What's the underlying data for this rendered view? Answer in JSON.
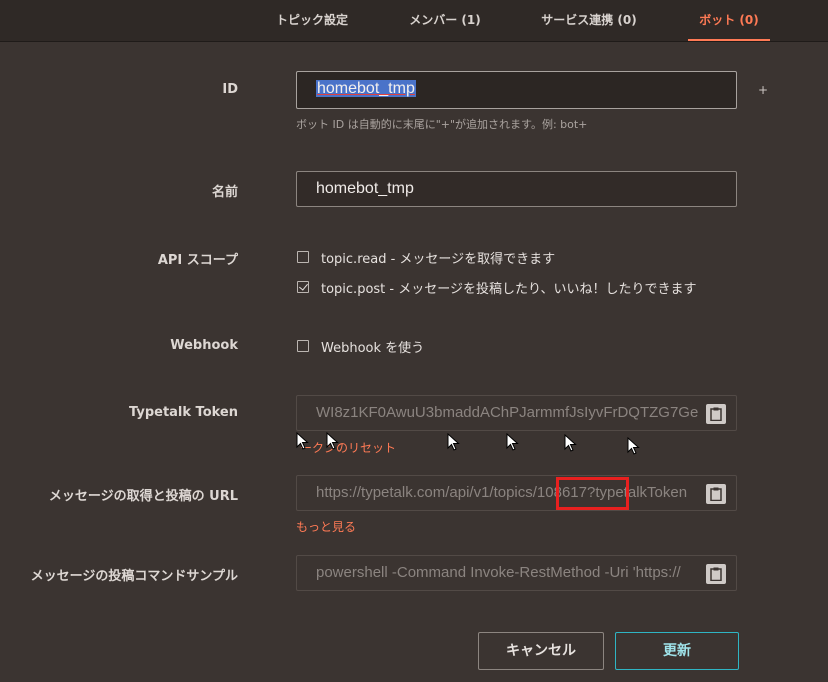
{
  "tabs": [
    {
      "label": "トピック設定"
    },
    {
      "label": "メンバー (1)"
    },
    {
      "label": "サービス連携 (0)"
    },
    {
      "label": "ボット (0)"
    }
  ],
  "form": {
    "id_label": "ID",
    "id_value": "homebot_tmp",
    "id_suffix": "+",
    "id_hint": "ボット ID は自動的に末尾に\"+\"が追加されます。例: bot+",
    "name_label": "名前",
    "name_value": "homebot_tmp",
    "api_label": "API スコープ",
    "scope_read": "topic.read - メッセージを取得できます",
    "scope_post": "topic.post - メッセージを投稿したり、いいね！したりできます",
    "webhook_label": "Webhook",
    "webhook_option": "Webhook を使う",
    "token_label": "Typetalk Token",
    "token_value": "WI8z1KF0AwuU3bmaddAChPJarmmfJsIyvFrDQTZG7Ge",
    "token_reset": "ークンのリセット",
    "url_label": "メッセージの取得と投稿の URL",
    "url_value": "https://typetalk.com/api/v1/topics/108617?typetalkToken",
    "url_more": "もっと見る",
    "cmd_label": "メッセージの投稿コマンドサンプル",
    "cmd_value": "powershell -Command Invoke-RestMethod -Uri 'https://",
    "cancel_label": "キャンセル",
    "update_label": "更新"
  },
  "colors": {
    "accent": "#ff7a55",
    "primary_border": "#2fb5c4",
    "highlight": "#e8201f",
    "selection": "#4a73c9"
  }
}
